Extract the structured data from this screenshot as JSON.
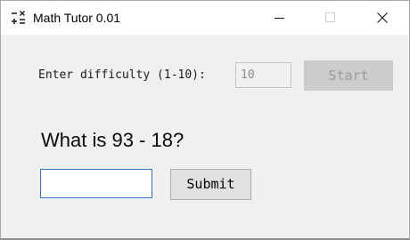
{
  "window": {
    "title": "Math Tutor 0.01",
    "app_icon": "calculator-operators-icon",
    "controls": [
      "minimize-icon",
      "maximize-icon",
      "close-icon"
    ]
  },
  "difficulty": {
    "label": "Enter difficulty (1-10):",
    "value": "10",
    "start_label": "Start"
  },
  "question": {
    "text": "What is 93 - 18?"
  },
  "answer": {
    "value": "",
    "submit_label": "Submit"
  },
  "colors": {
    "focus_border": "#2e74c7",
    "window_bg": "#f0f0f0",
    "disabled_text": "#9b9b9b"
  }
}
